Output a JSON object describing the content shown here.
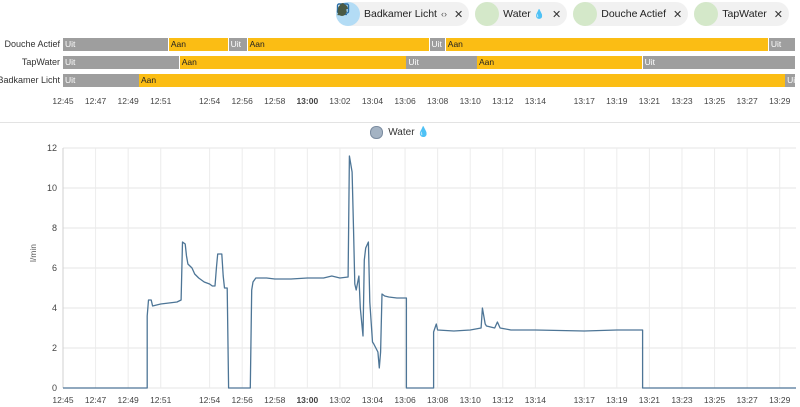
{
  "chips": [
    {
      "label": "Badkamer Licht",
      "icon": "bathroom-light-icon",
      "extra": "‹›",
      "active_color": "#b3dcf5"
    },
    {
      "label": "Water",
      "icon": "water-drop-icon",
      "emoji": "💧",
      "active_color": "#d4e8c9"
    },
    {
      "label": "Douche Actief",
      "icon": "shower-icon",
      "active_color": "#d4e8c9"
    },
    {
      "label": "TapWater",
      "icon": "faucet-icon",
      "active_color": "#d4e8c9"
    }
  ],
  "timeline": {
    "time_range": [
      "12:45",
      "13:30"
    ],
    "rows": [
      {
        "label": "Douche Actief",
        "segments": [
          {
            "state": "Uit",
            "start": "12:45:00",
            "end": "12:51:30"
          },
          {
            "state": "Aan",
            "start": "12:51:30",
            "end": "12:55:10"
          },
          {
            "state": "Uit",
            "start": "12:55:10",
            "end": "12:56:20"
          },
          {
            "state": "Aan",
            "start": "12:56:20",
            "end": "13:07:30"
          },
          {
            "state": "Uit",
            "start": "13:07:30",
            "end": "13:08:30"
          },
          {
            "state": "Aan",
            "start": "13:08:30",
            "end": "13:28:20"
          },
          {
            "state": "Uit",
            "start": "13:28:20",
            "end": "13:30:00"
          }
        ]
      },
      {
        "label": "TapWater",
        "segments": [
          {
            "state": "Uit",
            "start": "12:45:00",
            "end": "12:52:10"
          },
          {
            "state": "Aan",
            "start": "12:52:10",
            "end": "13:06:05"
          },
          {
            "state": "Uit",
            "start": "13:06:05",
            "end": "13:10:25"
          },
          {
            "state": "Aan",
            "start": "13:10:25",
            "end": "13:20:35"
          },
          {
            "state": "Uit",
            "start": "13:20:35",
            "end": "13:30:00"
          }
        ]
      },
      {
        "label": "Badkamer Licht",
        "segments": [
          {
            "state": "Uit",
            "start": "12:45:00",
            "end": "12:49:40"
          },
          {
            "state": "Aan",
            "start": "12:49:40",
            "end": "13:29:20"
          },
          {
            "state": "Uit",
            "start": "13:29:20",
            "end": "13:30:00"
          }
        ]
      }
    ],
    "ticks": [
      {
        "t": "12:45",
        "bold": false
      },
      {
        "t": "12:47",
        "bold": false
      },
      {
        "t": "12:49",
        "bold": false
      },
      {
        "t": "12:51",
        "bold": false
      },
      {
        "t": "12:54",
        "bold": false
      },
      {
        "t": "12:56",
        "bold": false
      },
      {
        "t": "12:58",
        "bold": false
      },
      {
        "t": "13:00",
        "bold": true
      },
      {
        "t": "13:02",
        "bold": false
      },
      {
        "t": "13:04",
        "bold": false
      },
      {
        "t": "13:06",
        "bold": false
      },
      {
        "t": "13:08",
        "bold": false
      },
      {
        "t": "13:10",
        "bold": false
      },
      {
        "t": "13:12",
        "bold": false
      },
      {
        "t": "13:14",
        "bold": false
      },
      {
        "t": "13:17",
        "bold": false
      },
      {
        "t": "13:19",
        "bold": false
      },
      {
        "t": "13:21",
        "bold": false
      },
      {
        "t": "13:23",
        "bold": false
      },
      {
        "t": "13:25",
        "bold": false
      },
      {
        "t": "13:27",
        "bold": false
      },
      {
        "t": "13:29",
        "bold": false
      }
    ]
  },
  "chart_data": {
    "type": "line",
    "legend": [
      {
        "name": "Water 💧",
        "color": "#a4b3c3"
      }
    ],
    "ylabel": "l/min",
    "ylim": [
      0,
      12
    ],
    "yticks": [
      0,
      2,
      4,
      6,
      8,
      10,
      12
    ],
    "xlim": [
      "12:45",
      "13:30"
    ],
    "xticks": [
      "12:45",
      "12:47",
      "12:49",
      "12:51",
      "12:54",
      "12:56",
      "12:58",
      "13:00",
      "13:02",
      "13:04",
      "13:06",
      "13:08",
      "13:10",
      "13:12",
      "13:14",
      "13:17",
      "13:19",
      "13:21",
      "13:23",
      "13:25",
      "13:27",
      "13:29"
    ],
    "grid": true,
    "line_color": "#4d7596",
    "series": [
      {
        "name": "Water 💧",
        "points": [
          [
            "12:45:00",
            0
          ],
          [
            "12:50:10",
            0
          ],
          [
            "12:50:10",
            3.6
          ],
          [
            "12:50:15",
            4.4
          ],
          [
            "12:50:25",
            4.4
          ],
          [
            "12:50:30",
            4.1
          ],
          [
            "12:51:00",
            4.2
          ],
          [
            "12:51:30",
            4.25
          ],
          [
            "12:52:00",
            4.3
          ],
          [
            "12:52:15",
            4.4
          ],
          [
            "12:52:20",
            7.3
          ],
          [
            "12:52:30",
            7.2
          ],
          [
            "12:52:35",
            6.6
          ],
          [
            "12:52:40",
            6.2
          ],
          [
            "12:52:55",
            6.0
          ],
          [
            "12:53:05",
            5.7
          ],
          [
            "12:53:20",
            5.5
          ],
          [
            "12:53:40",
            5.3
          ],
          [
            "12:54:00",
            5.2
          ],
          [
            "12:54:10",
            5.1
          ],
          [
            "12:54:20",
            5.1
          ],
          [
            "12:54:25",
            6.0
          ],
          [
            "12:54:30",
            6.7
          ],
          [
            "12:54:45",
            6.7
          ],
          [
            "12:54:50",
            5.6
          ],
          [
            "12:54:55",
            5.0
          ],
          [
            "12:55:05",
            5.0
          ],
          [
            "12:55:10",
            0
          ],
          [
            "12:56:30",
            0
          ],
          [
            "12:56:35",
            4.9
          ],
          [
            "12:56:40",
            5.3
          ],
          [
            "12:56:50",
            5.5
          ],
          [
            "12:57:30",
            5.5
          ],
          [
            "12:58:00",
            5.45
          ],
          [
            "12:59:00",
            5.45
          ],
          [
            "13:00:00",
            5.5
          ],
          [
            "13:01:00",
            5.5
          ],
          [
            "13:01:30",
            5.6
          ],
          [
            "13:02:00",
            5.5
          ],
          [
            "13:02:30",
            5.55
          ],
          [
            "13:02:35",
            11.6
          ],
          [
            "13:02:45",
            10.8
          ],
          [
            "13:02:50",
            8.0
          ],
          [
            "13:02:55",
            5.2
          ],
          [
            "13:03:00",
            4.9
          ],
          [
            "13:03:10",
            5.6
          ],
          [
            "13:03:15",
            4.0
          ],
          [
            "13:03:25",
            2.6
          ],
          [
            "13:03:30",
            6.4
          ],
          [
            "13:03:35",
            7.0
          ],
          [
            "13:03:45",
            7.3
          ],
          [
            "13:03:50",
            4.3
          ],
          [
            "13:04:00",
            2.3
          ],
          [
            "13:04:05",
            2.2
          ],
          [
            "13:04:20",
            1.8
          ],
          [
            "13:04:25",
            1.0
          ],
          [
            "13:04:30",
            1.8
          ],
          [
            "13:04:35",
            4.7
          ],
          [
            "13:04:45",
            4.6
          ],
          [
            "13:05:00",
            4.55
          ],
          [
            "13:05:30",
            4.5
          ],
          [
            "13:06:05",
            4.5
          ],
          [
            "13:06:05",
            0
          ],
          [
            "13:07:45",
            0
          ],
          [
            "13:07:45",
            2.8
          ],
          [
            "13:07:55",
            3.2
          ],
          [
            "13:08:00",
            2.9
          ],
          [
            "13:09:00",
            2.85
          ],
          [
            "13:10:00",
            2.9
          ],
          [
            "13:10:40",
            3.0
          ],
          [
            "13:10:45",
            4.0
          ],
          [
            "13:10:55",
            3.2
          ],
          [
            "13:11:00",
            3.1
          ],
          [
            "13:11:30",
            3.0
          ],
          [
            "13:11:40",
            3.3
          ],
          [
            "13:11:50",
            3.0
          ],
          [
            "13:12:30",
            2.9
          ],
          [
            "13:14:00",
            2.9
          ],
          [
            "13:17:00",
            2.85
          ],
          [
            "13:19:00",
            2.9
          ],
          [
            "13:20:35",
            2.9
          ],
          [
            "13:20:35",
            0
          ],
          [
            "13:30:00",
            0
          ]
        ]
      }
    ]
  }
}
